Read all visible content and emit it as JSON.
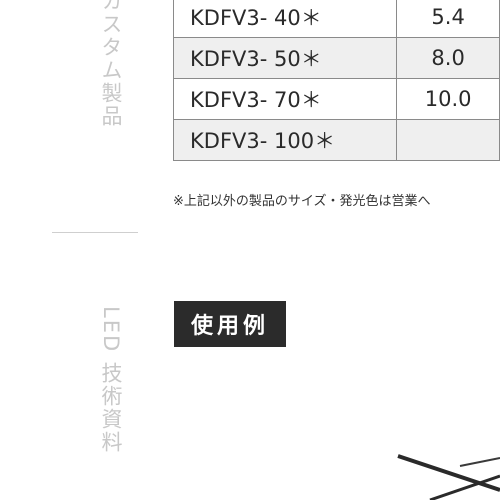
{
  "sidebar": {
    "top_label": "カスタム製品",
    "bottom_label": "LED 技術資料"
  },
  "spec_table": {
    "rows": [
      {
        "model": "KDFV3- 40＊",
        "value": "5.4"
      },
      {
        "model": "KDFV3- 50＊",
        "value": "8.0"
      },
      {
        "model": "KDFV3- 70＊",
        "value": "10.0"
      },
      {
        "model": "KDFV3- 100＊",
        "value": ""
      }
    ]
  },
  "note": "※上記以外の製品のサイズ・発光色は営業へ",
  "section": {
    "title": "使用例"
  }
}
